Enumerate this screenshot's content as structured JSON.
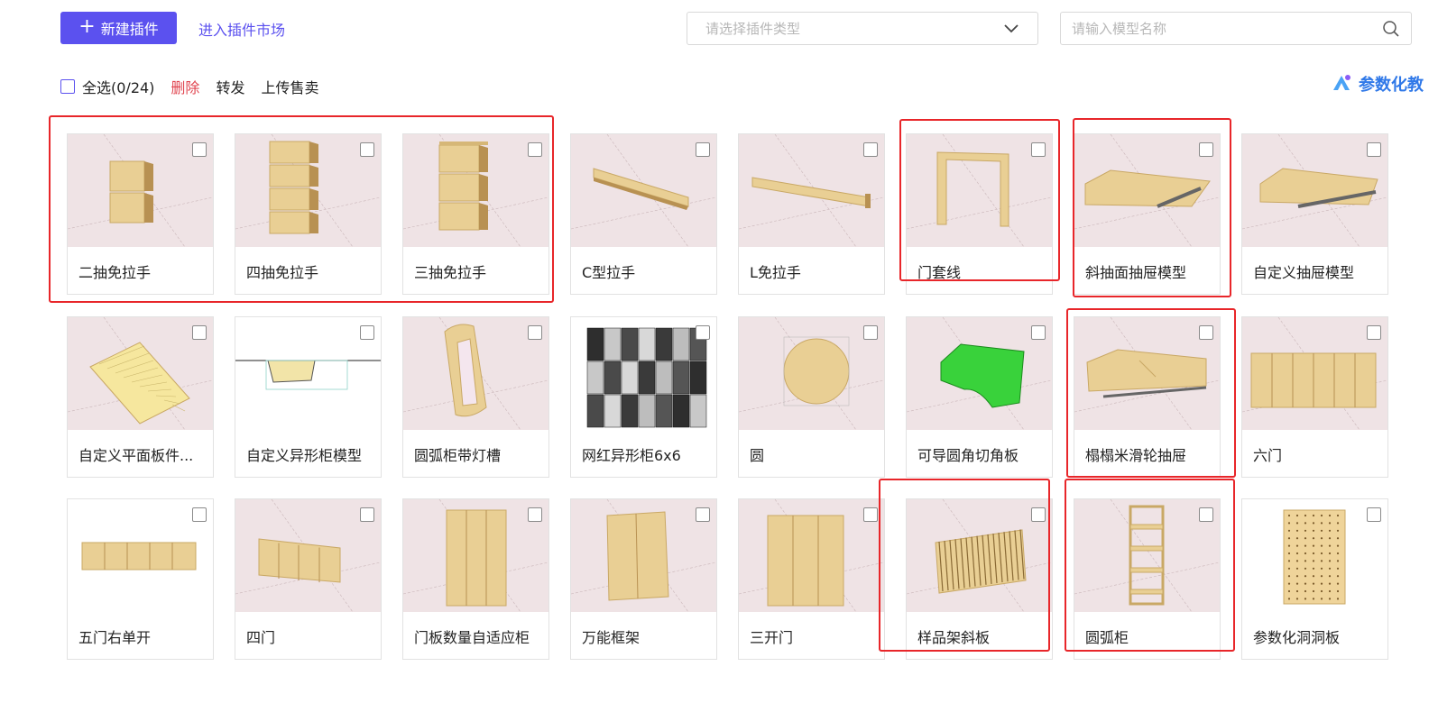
{
  "toolbar": {
    "new_plugin": "新建插件",
    "market": "进入插件市场",
    "type_placeholder": "请选择插件类型",
    "search_placeholder": "请输入模型名称"
  },
  "bulk": {
    "select_all": "全选(0/24)",
    "delete": "删除",
    "forward": "转发",
    "upload_sell": "上传售卖"
  },
  "param_link": "参数化教",
  "colors": {
    "accent": "#5b51ef",
    "danger": "#e0444f",
    "highlight": "#e8262a",
    "thumb_bg": "#efe3e5"
  },
  "cards": [
    {
      "name": "二抽免拉手",
      "icon": "two-drawer-icon"
    },
    {
      "name": "四抽免拉手",
      "icon": "four-drawer-icon"
    },
    {
      "name": "三抽免拉手",
      "icon": "three-drawer-icon"
    },
    {
      "name": "C型拉手",
      "icon": "c-handle-icon"
    },
    {
      "name": "L免拉手",
      "icon": "l-handle-icon"
    },
    {
      "name": "门套线",
      "icon": "door-frame-icon"
    },
    {
      "name": "斜抽面抽屉模型",
      "icon": "slant-drawer-icon"
    },
    {
      "name": "自定义抽屉模型",
      "icon": "custom-drawer-icon"
    },
    {
      "name": "自定义平面板件...",
      "icon": "flat-panel-icon"
    },
    {
      "name": "自定义异形柜模型",
      "icon": "shaped-cabinet-icon"
    },
    {
      "name": "圆弧柜带灯槽",
      "icon": "arc-light-cabinet-icon"
    },
    {
      "name": "网红异形柜6x6",
      "icon": "grid-cabinet-icon"
    },
    {
      "name": "圆",
      "icon": "circle-panel-icon"
    },
    {
      "name": "可导圆角切角板",
      "icon": "rounded-board-icon"
    },
    {
      "name": "榻榻米滑轮抽屉",
      "icon": "tatami-drawer-icon"
    },
    {
      "name": "六门",
      "icon": "six-door-icon"
    },
    {
      "name": "五门右单开",
      "icon": "five-door-icon"
    },
    {
      "name": "四门",
      "icon": "four-door-icon"
    },
    {
      "name": "门板数量自适应柜",
      "icon": "adaptive-cabinet-icon"
    },
    {
      "name": "万能框架",
      "icon": "frame-cabinet-icon"
    },
    {
      "name": "三开门",
      "icon": "three-door-icon"
    },
    {
      "name": "样品架斜板",
      "icon": "sample-rack-icon"
    },
    {
      "name": "圆弧柜",
      "icon": "arc-shelf-icon"
    },
    {
      "name": "参数化洞洞板",
      "icon": "pegboard-icon"
    }
  ]
}
